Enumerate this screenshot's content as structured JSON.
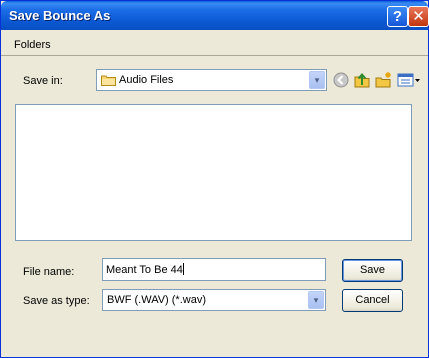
{
  "window": {
    "title": "Save Bounce As"
  },
  "titlebar": {
    "help_label": "?",
    "close_label": "✕"
  },
  "folders_bar": {
    "label": "Folders"
  },
  "save_in": {
    "label": "Save in:",
    "value": "Audio Files",
    "dropdown_glyph": "▾"
  },
  "toolbar": {
    "icons": [
      "back-icon",
      "up-folder-icon",
      "new-folder-icon",
      "views-menu-icon"
    ]
  },
  "file_name": {
    "label": "File name:",
    "value": "Meant To Be 44"
  },
  "save_as_type": {
    "label": "Save as type:",
    "value": "BWF (.WAV) (*.wav)",
    "dropdown_glyph": "▾"
  },
  "buttons": {
    "save_label": "Save",
    "cancel_label": "Cancel"
  },
  "colors": {
    "titlebar": "#0a5fd8",
    "dialog_bg": "#ece9d8",
    "border": "#7f9db9"
  }
}
